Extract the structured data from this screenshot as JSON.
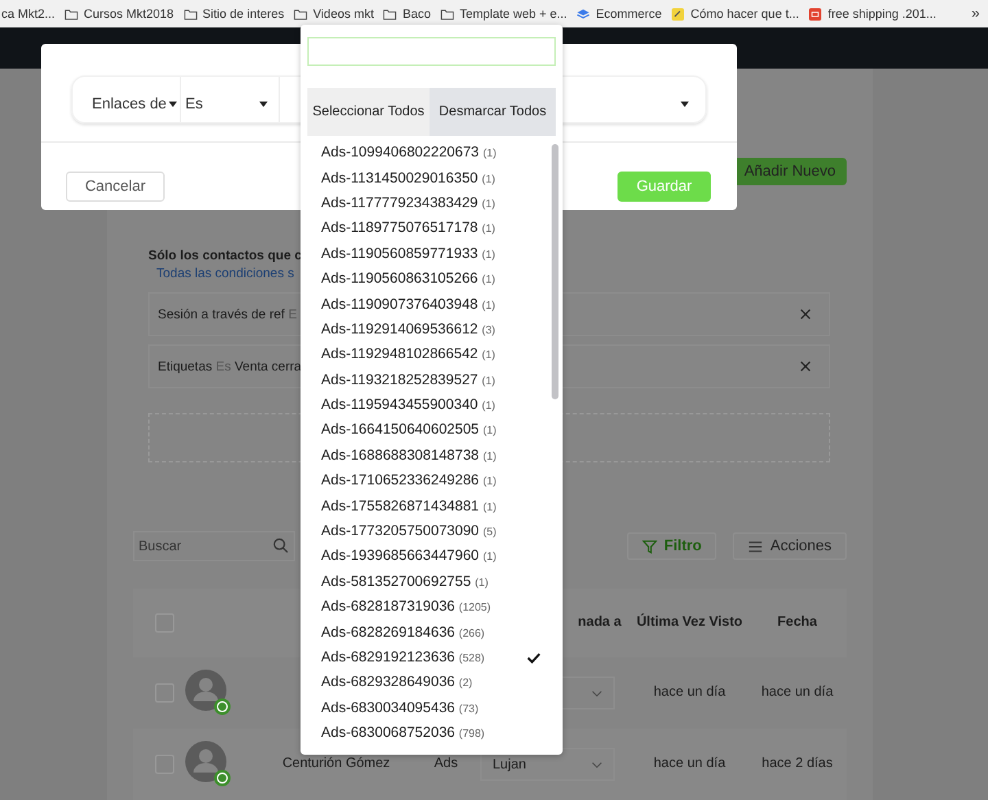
{
  "bookmarks": [
    {
      "label": "ca Mkt2...",
      "kind": "none"
    },
    {
      "label": "Cursos Mkt2018",
      "kind": "folder"
    },
    {
      "label": "Sitio de interes",
      "kind": "folder"
    },
    {
      "label": "Videos mkt",
      "kind": "folder"
    },
    {
      "label": "Baco",
      "kind": "folder"
    },
    {
      "label": "Template web + e...",
      "kind": "folder"
    },
    {
      "label": "Ecommerce",
      "kind": "stack"
    },
    {
      "label": "Cómo hacer que t...",
      "kind": "note"
    },
    {
      "label": "free shipping .201...",
      "kind": "shop"
    }
  ],
  "bookmarks_more": "»",
  "modal": {
    "filter": {
      "field": "Enlaces de",
      "operator": "Es"
    },
    "cancel": "Cancelar",
    "save": "Guardar"
  },
  "dropdown": {
    "select_all": "Seleccionar Todos",
    "deselect_all": "Desmarcar Todos",
    "options": [
      {
        "label": "Ads-1099406802220673",
        "count": "(1)",
        "selected": false
      },
      {
        "label": "Ads-1131450029016350",
        "count": "(1)",
        "selected": false
      },
      {
        "label": "Ads-1177779234383429",
        "count": "(1)",
        "selected": false
      },
      {
        "label": "Ads-1189775076517178",
        "count": "(1)",
        "selected": false
      },
      {
        "label": "Ads-1190560859771933",
        "count": "(1)",
        "selected": false
      },
      {
        "label": "Ads-1190560863105266",
        "count": "(1)",
        "selected": false
      },
      {
        "label": "Ads-1190907376403948",
        "count": "(1)",
        "selected": false
      },
      {
        "label": "Ads-1192914069536612",
        "count": "(3)",
        "selected": false
      },
      {
        "label": "Ads-1192948102866542",
        "count": "(1)",
        "selected": false
      },
      {
        "label": "Ads-1193218252839527",
        "count": "(1)",
        "selected": false
      },
      {
        "label": "Ads-1195943455900340",
        "count": "(1)",
        "selected": false
      },
      {
        "label": "Ads-1664150640602505",
        "count": "(1)",
        "selected": false
      },
      {
        "label": "Ads-1688688308148738",
        "count": "(1)",
        "selected": false
      },
      {
        "label": "Ads-1710652336249286",
        "count": "(1)",
        "selected": false
      },
      {
        "label": "Ads-1755826871434881",
        "count": "(1)",
        "selected": false
      },
      {
        "label": "Ads-1773205750073090",
        "count": "(5)",
        "selected": false
      },
      {
        "label": "Ads-1939685663447960",
        "count": "(1)",
        "selected": false
      },
      {
        "label": "Ads-581352700692755",
        "count": "(1)",
        "selected": false
      },
      {
        "label": "Ads-6828187319036",
        "count": "(1205)",
        "selected": false
      },
      {
        "label": "Ads-6828269184636",
        "count": "(266)",
        "selected": false
      },
      {
        "label": "Ads-6829192123636",
        "count": "(528)",
        "selected": true
      },
      {
        "label": "Ads-6829328649036",
        "count": "(2)",
        "selected": false
      },
      {
        "label": "Ads-6830034095436",
        "count": "(73)",
        "selected": false
      },
      {
        "label": "Ads-6830068752036",
        "count": "(798)",
        "selected": false
      }
    ]
  },
  "page": {
    "add_button": "Añadir Nuevo",
    "rules_title": "Sólo los contactos que c",
    "rules_link": "Todas las condiciones s",
    "conditions": [
      {
        "field": "Sesión a través de ref",
        "operator": "E"
      },
      {
        "field": "Etiquetas",
        "operator": "Es",
        "value": "Venta cerra"
      }
    ]
  },
  "toolbar": {
    "search_placeholder": "Buscar",
    "filter": "Filtro",
    "actions": "Acciones"
  },
  "table": {
    "header_checked": false,
    "columns": [
      "nada a",
      "Última Vez Visto",
      "Fecha"
    ],
    "rows": [
      {
        "checked": false,
        "last_seen": "hace un día",
        "date": "hace un día"
      },
      {
        "checked": false,
        "name": "Centurión Gómez",
        "source": "Ads",
        "assigned": "Lujan",
        "last_seen": "hace un día",
        "date": "hace 2 días"
      }
    ]
  }
}
